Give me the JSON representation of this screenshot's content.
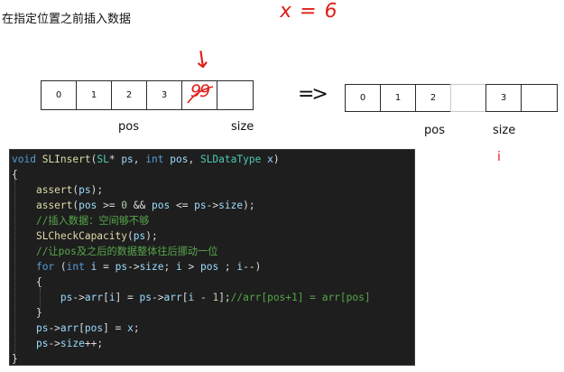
{
  "heading": "在指定位置之前插入数据",
  "annotations": {
    "x_value": "x = 6",
    "overwritten_cell": "99",
    "arrow": "↓",
    "implies": "=>",
    "i_marker": "i"
  },
  "before_array": {
    "cells": [
      "0",
      "1",
      "2",
      "3",
      "",
      ""
    ],
    "pos_label": "pos",
    "size_label": "size"
  },
  "after_array": {
    "cells": [
      "0",
      "1",
      "2",
      "",
      "3",
      ""
    ],
    "pos_label": "pos",
    "size_label": "size"
  },
  "code_lines": [
    [
      [
        "k",
        "void"
      ],
      [
        "p",
        " "
      ],
      [
        "f",
        "SLInsert"
      ],
      [
        "p",
        "("
      ],
      [
        "t",
        "SL"
      ],
      [
        "p",
        "* "
      ],
      [
        "v",
        "ps"
      ],
      [
        "p",
        ", "
      ],
      [
        "k",
        "int"
      ],
      [
        "p",
        " "
      ],
      [
        "v",
        "pos"
      ],
      [
        "p",
        ", "
      ],
      [
        "t",
        "SLDataType"
      ],
      [
        "p",
        " "
      ],
      [
        "v",
        "x"
      ],
      [
        "p",
        ")"
      ]
    ],
    [
      [
        "p",
        "{"
      ]
    ],
    [
      [
        "p",
        "    "
      ],
      [
        "f",
        "assert"
      ],
      [
        "p",
        "("
      ],
      [
        "v",
        "ps"
      ],
      [
        "p",
        ");"
      ]
    ],
    [
      [
        "p",
        "    "
      ],
      [
        "f",
        "assert"
      ],
      [
        "p",
        "("
      ],
      [
        "v",
        "pos"
      ],
      [
        "p",
        " >= "
      ],
      [
        "n",
        "0"
      ],
      [
        "p",
        " && "
      ],
      [
        "v",
        "pos"
      ],
      [
        "p",
        " <= "
      ],
      [
        "v",
        "ps"
      ],
      [
        "p",
        "->"
      ],
      [
        "v",
        "size"
      ],
      [
        "p",
        ");"
      ]
    ],
    [
      [
        "p",
        "    "
      ],
      [
        "c",
        "//插入数据：空间够不够"
      ]
    ],
    [
      [
        "p",
        "    "
      ],
      [
        "f",
        "SLCheckCapacity"
      ],
      [
        "p",
        "("
      ],
      [
        "v",
        "ps"
      ],
      [
        "p",
        ");"
      ]
    ],
    [
      [
        "p",
        "    "
      ],
      [
        "c",
        "//让pos及之后的数据整体往后挪动一位"
      ]
    ],
    [
      [
        "p",
        "    "
      ],
      [
        "k",
        "for"
      ],
      [
        "p",
        " ("
      ],
      [
        "k",
        "int"
      ],
      [
        "p",
        " "
      ],
      [
        "v",
        "i"
      ],
      [
        "p",
        " = "
      ],
      [
        "v",
        "ps"
      ],
      [
        "p",
        "->"
      ],
      [
        "v",
        "size"
      ],
      [
        "p",
        "; "
      ],
      [
        "v",
        "i"
      ],
      [
        "p",
        " > "
      ],
      [
        "v",
        "pos"
      ],
      [
        "p",
        " ; "
      ],
      [
        "v",
        "i"
      ],
      [
        "p",
        "--)"
      ]
    ],
    [
      [
        "p",
        "    {"
      ]
    ],
    [
      [
        "p",
        "        "
      ],
      [
        "v",
        "ps"
      ],
      [
        "p",
        "->"
      ],
      [
        "v",
        "arr"
      ],
      [
        "p",
        "["
      ],
      [
        "v",
        "i"
      ],
      [
        "p",
        "] = "
      ],
      [
        "v",
        "ps"
      ],
      [
        "p",
        "->"
      ],
      [
        "v",
        "arr"
      ],
      [
        "p",
        "["
      ],
      [
        "v",
        "i"
      ],
      [
        "p",
        " - "
      ],
      [
        "n",
        "1"
      ],
      [
        "p",
        "];"
      ],
      [
        "c",
        "//arr[pos+1] = arr[pos]"
      ]
    ],
    [
      [
        "p",
        "    }"
      ]
    ],
    [
      [
        "p",
        "    "
      ],
      [
        "v",
        "ps"
      ],
      [
        "p",
        "->"
      ],
      [
        "v",
        "arr"
      ],
      [
        "p",
        "["
      ],
      [
        "v",
        "pos"
      ],
      [
        "p",
        "] = "
      ],
      [
        "v",
        "x"
      ],
      [
        "p",
        ";"
      ]
    ],
    [
      [
        "p",
        "    "
      ],
      [
        "v",
        "ps"
      ],
      [
        "p",
        "->"
      ],
      [
        "v",
        "size"
      ],
      [
        "p",
        "++;"
      ]
    ],
    [
      [
        "p",
        "}"
      ]
    ]
  ],
  "colors": {
    "editor_bg": "#1e1e1e",
    "keyword": "#569cd6",
    "function": "#dcdcaa",
    "type": "#4ec9b0",
    "variable": "#9cdcfe",
    "number": "#b5cea8",
    "comment": "#57a64a",
    "annotation_red": "#e0201b"
  }
}
